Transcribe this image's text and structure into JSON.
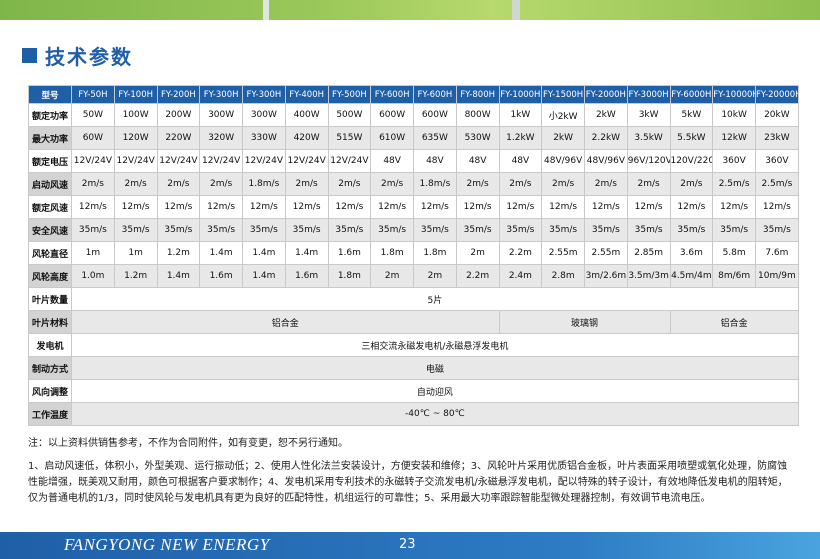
{
  "section_title": "技术参数",
  "table": {
    "header_label": "型号",
    "models": [
      "FY-50H",
      "FY-100H",
      "FY-200H",
      "FY-300H",
      "FY-300H",
      "FY-400H",
      "FY-500H",
      "FY-600H",
      "FY-600H",
      "FY-800H",
      "FY-1000H",
      "FY-1500H",
      "FY-2000H",
      "FY-3000H",
      "FY-6000H",
      "FY-10000H",
      "FY-20000H"
    ],
    "rows": [
      {
        "label": "额定功率",
        "values": [
          "50W",
          "100W",
          "200W",
          "300W",
          "300W",
          "400W",
          "500W",
          "600W",
          "600W",
          "800W",
          "1kW",
          "小2kW",
          "2kW",
          "3kW",
          "5kW",
          "10kW",
          "20kW"
        ]
      },
      {
        "label": "最大功率",
        "values": [
          "60W",
          "120W",
          "220W",
          "320W",
          "330W",
          "420W",
          "515W",
          "610W",
          "635W",
          "530W",
          "1.2kW",
          "2kW",
          "2.2kW",
          "3.5kW",
          "5.5kW",
          "12kW",
          "23kW"
        ]
      },
      {
        "label": "额定电压",
        "values": [
          "12V/24V",
          "12V/24V",
          "12V/24V",
          "12V/24V",
          "12V/24V",
          "12V/24V",
          "12V/24V",
          "48V",
          "48V",
          "48V",
          "48V",
          "48V/96V",
          "48V/96V",
          "96V/120V",
          "120V/220V",
          "360V",
          "360V"
        ]
      },
      {
        "label": "启动风速",
        "values": [
          "2m/s",
          "2m/s",
          "2m/s",
          "2m/s",
          "1.8m/s",
          "2m/s",
          "2m/s",
          "2m/s",
          "1.8m/s",
          "2m/s",
          "2m/s",
          "2m/s",
          "2m/s",
          "2m/s",
          "2m/s",
          "2.5m/s",
          "2.5m/s"
        ]
      },
      {
        "label": "额定风速",
        "values": [
          "12m/s",
          "12m/s",
          "12m/s",
          "12m/s",
          "12m/s",
          "12m/s",
          "12m/s",
          "12m/s",
          "12m/s",
          "12m/s",
          "12m/s",
          "12m/s",
          "12m/s",
          "12m/s",
          "12m/s",
          "12m/s",
          "12m/s"
        ]
      },
      {
        "label": "安全风速",
        "values": [
          "35m/s",
          "35m/s",
          "35m/s",
          "35m/s",
          "35m/s",
          "35m/s",
          "35m/s",
          "35m/s",
          "35m/s",
          "35m/s",
          "35m/s",
          "35m/s",
          "35m/s",
          "35m/s",
          "35m/s",
          "35m/s",
          "35m/s"
        ]
      },
      {
        "label": "风轮直径",
        "values": [
          "1m",
          "1m",
          "1.2m",
          "1.4m",
          "1.4m",
          "1.4m",
          "1.6m",
          "1.8m",
          "1.8m",
          "2m",
          "2.2m",
          "2.55m",
          "2.55m",
          "2.85m",
          "3.6m",
          "5.8m",
          "7.6m"
        ]
      },
      {
        "label": "风轮高度",
        "values": [
          "1.0m",
          "1.2m",
          "1.4m",
          "1.6m",
          "1.4m",
          "1.6m",
          "1.8m",
          "2m",
          "2m",
          "2.2m",
          "2.4m",
          "2.8m",
          "3m/2.6m",
          "3.5m/3m",
          "4.5m/4m",
          "8m/6m",
          "10m/9m"
        ]
      }
    ],
    "blade_count_label": "叶片数量",
    "blade_count_value": "5片",
    "blade_material_label": "叶片材料",
    "blade_material_a": "铝合金",
    "blade_material_b": "玻璃钢",
    "blade_material_c": "铝合金",
    "generator_label": "发电机",
    "generator_value": "三相交流永磁发电机/永磁悬浮发电机",
    "brake_label": "制动方式",
    "brake_value": "电磁",
    "yaw_label": "风向调整",
    "yaw_value": "自动迎风",
    "temp_label": "工作温度",
    "temp_value": "-40℃ ~ 80℃"
  },
  "note": "注：以上资料供销售参考，不作为合同附件，如有变更，恕不另行通知。",
  "features_text": "1、启动风速低，体积小，外型美观、运行振动低；2、使用人性化法兰安装设计，方便安装和维修；3、风轮叶片采用优质铝合金板，叶片表面采用喷塑或氧化处理，防腐蚀性能增强，既美观又耐用，颜色可根据客户要求制作；4、发电机采用专利技术的永磁转子交流发电机/永磁悬浮发电机，配以特殊的转子设计，有效地降低发电机的阻转矩，仅为普通电机的1/3，同时使风轮与发电机具有更为良好的匹配特性，机组运行的可靠性；5、采用最大功率跟踪智能型微处理器控制，有效调节电流电压。",
  "footer": {
    "brand": "FANGYONG NEW ENERGY",
    "page_number": "23"
  },
  "colors": {
    "accent": "#1f5fa8",
    "banner_green": "#8fbf4f"
  }
}
